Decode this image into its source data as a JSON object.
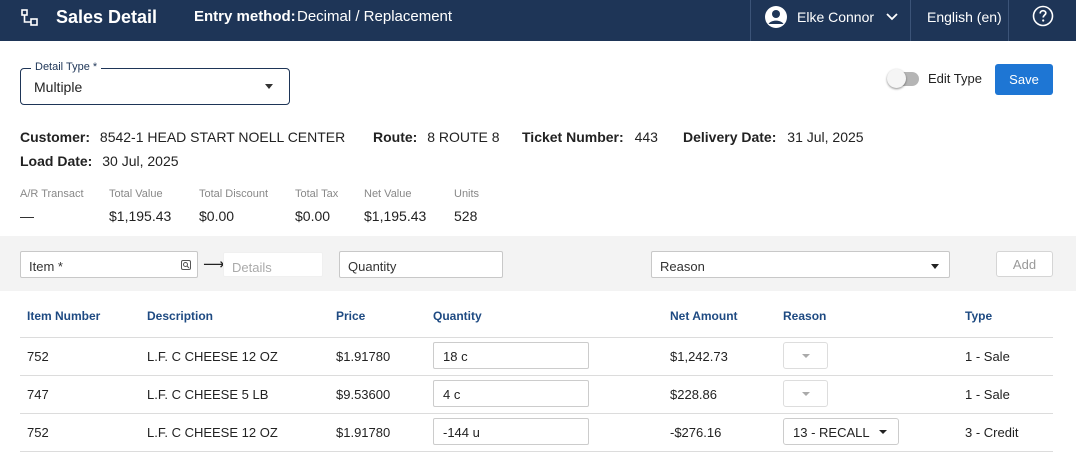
{
  "header": {
    "title": "Sales Detail",
    "entry_label": "Entry method:",
    "entry_value": "Decimal / Replacement",
    "user_name": "Elke Connor",
    "language": "English (en)"
  },
  "detail_type": {
    "label": "Detail Type *",
    "value": "Multiple"
  },
  "edit_type_label": "Edit Type",
  "save_label": "Save",
  "info": {
    "customer_label": "Customer:",
    "customer_value": "8542-1 HEAD START NOELL CENTER",
    "route_label": "Route:",
    "route_value": "8 ROUTE 8",
    "ticket_label": "Ticket Number:",
    "ticket_value": "443",
    "delivery_label": "Delivery Date:",
    "delivery_value": "31 Jul, 2025",
    "load_label": "Load Date:",
    "load_value": "30 Jul, 2025"
  },
  "stats": [
    {
      "label": "A/R Transact",
      "value": "—"
    },
    {
      "label": "Total Value",
      "value": "$1,195.43"
    },
    {
      "label": "Total Discount",
      "value": "$0.00"
    },
    {
      "label": "Total Tax",
      "value": "$0.00"
    },
    {
      "label": "Net Value",
      "value": "$1,195.43"
    },
    {
      "label": "Units",
      "value": "528"
    }
  ],
  "entry": {
    "item_placeholder": "Item *",
    "details_placeholder": "Details",
    "quantity_placeholder": "Quantity",
    "reason_placeholder": "Reason",
    "add_label": "Add"
  },
  "table": {
    "columns": [
      "Item Number",
      "Description",
      "Price",
      "Quantity",
      "Net Amount",
      "Reason",
      "Type"
    ],
    "rows": [
      {
        "item": "752",
        "description": "L.F. C CHEESE 12 OZ",
        "price": "$1.91780",
        "quantity": "18 c",
        "net": "$1,242.73",
        "reason": "",
        "type": "1 - Sale"
      },
      {
        "item": "747",
        "description": "L.F. C CHEESE 5 LB",
        "price": "$9.53600",
        "quantity": "4 c",
        "net": "$228.86",
        "reason": "",
        "type": "1 - Sale"
      },
      {
        "item": "752",
        "description": "L.F. C CHEESE 12 OZ",
        "price": "$1.91780",
        "quantity": "-144 u",
        "net": "-$276.16",
        "reason": "13 - RECALL",
        "type": "3 - Credit"
      }
    ]
  }
}
